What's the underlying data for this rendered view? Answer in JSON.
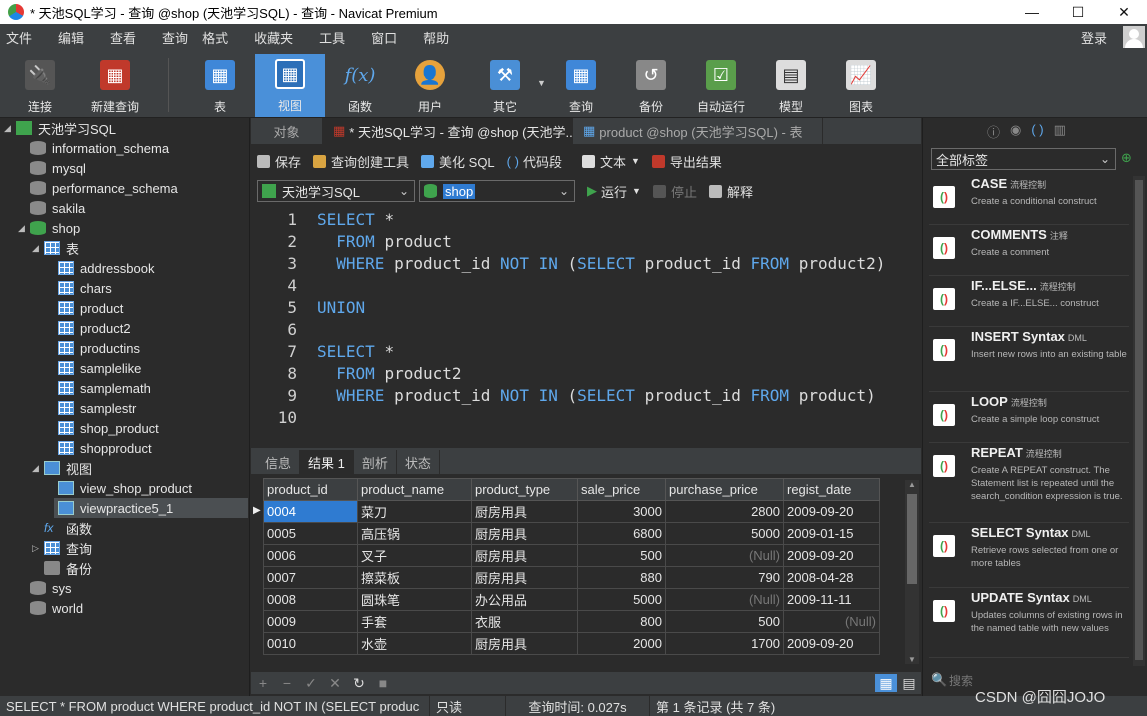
{
  "window": {
    "title": "* 天池SQL学习 - 查询 @shop (天池学习SQL) - 查询 - Navicat Premium"
  },
  "menu": [
    "文件",
    "编辑",
    "查看",
    "查询",
    "格式",
    "收藏夹",
    "工具",
    "窗口",
    "帮助"
  ],
  "login": "登录",
  "toolbar": [
    "连接",
    "新建查询",
    "表",
    "视图",
    "函数",
    "用户",
    "其它",
    "查询",
    "备份",
    "自动运行",
    "模型",
    "图表"
  ],
  "nav": {
    "connection": "天池学习SQL",
    "databases_top": [
      "information_schema",
      "mysql",
      "performance_schema",
      "sakila"
    ],
    "current_db": "shop",
    "tables_label": "表",
    "tables": [
      "addressbook",
      "chars",
      "product",
      "product2",
      "productins",
      "samplelike",
      "samplemath",
      "samplestr",
      "shop_product",
      "shopproduct"
    ],
    "views_label": "视图",
    "views": [
      "view_shop_product",
      "viewpractice5_1"
    ],
    "functions": "函数",
    "queries": "查询",
    "backups": "备份",
    "databases_bottom": [
      "sys",
      "world"
    ]
  },
  "tabs": [
    "对象",
    "* 天池SQL学习 - 查询 @shop (天池学...",
    "product @shop (天池学习SQL) - 表"
  ],
  "editor_toolbar": [
    "保存",
    "查询创建工具",
    "美化 SQL",
    "代码段",
    "文本",
    "导出结果"
  ],
  "selectors": {
    "connection": "天池学习SQL",
    "database": "shop",
    "run": "运行",
    "stop": "停止",
    "explain": "解释"
  },
  "code": [
    {
      "n": "1",
      "t": [
        [
          "kw",
          "SELECT"
        ],
        [
          "",
          "*"
        ]
      ]
    },
    {
      "n": "2",
      "t": [
        [
          "",
          "  "
        ],
        [
          "kw",
          "FROM"
        ],
        [
          "",
          "product"
        ]
      ]
    },
    {
      "n": "3",
      "t": [
        [
          "",
          "  "
        ],
        [
          "kw",
          "WHERE"
        ],
        [
          "",
          "product_id"
        ],
        [
          "kw",
          "NOT IN"
        ],
        [
          "",
          "("
        ],
        [
          "kw",
          "SELECT"
        ],
        [
          "",
          "product_id"
        ],
        [
          "kw",
          "FROM"
        ],
        [
          "",
          "product2)"
        ]
      ]
    },
    {
      "n": "4",
      "t": []
    },
    {
      "n": "5",
      "t": [
        [
          "kw",
          "UNION"
        ]
      ]
    },
    {
      "n": "6",
      "t": []
    },
    {
      "n": "7",
      "t": [
        [
          "kw",
          "SELECT"
        ],
        [
          "",
          "*"
        ]
      ]
    },
    {
      "n": "8",
      "t": [
        [
          "",
          "  "
        ],
        [
          "kw",
          "FROM"
        ],
        [
          "",
          "product2"
        ]
      ]
    },
    {
      "n": "9",
      "t": [
        [
          "",
          "  "
        ],
        [
          "kw",
          "WHERE"
        ],
        [
          "",
          "product_id"
        ],
        [
          "kw",
          "NOT IN"
        ],
        [
          "",
          "("
        ],
        [
          "kw",
          "SELECT"
        ],
        [
          "",
          "product_id"
        ],
        [
          "kw",
          "FROM"
        ],
        [
          "",
          "product)"
        ]
      ]
    },
    {
      "n": "10",
      "t": []
    }
  ],
  "result_tabs": [
    "信息",
    "结果 1",
    "剖析",
    "状态"
  ],
  "grid": {
    "columns": [
      "product_id",
      "product_name",
      "product_type",
      "sale_price",
      "purchase_price",
      "regist_date"
    ],
    "rows": [
      [
        "0004",
        "菜刀",
        "厨房用具",
        "3000",
        "2800",
        "2009-09-20"
      ],
      [
        "0005",
        "高压锅",
        "厨房用具",
        "6800",
        "5000",
        "2009-01-15"
      ],
      [
        "0006",
        "叉子",
        "厨房用具",
        "500",
        "(Null)",
        "2009-09-20"
      ],
      [
        "0007",
        "擦菜板",
        "厨房用具",
        "880",
        "790",
        "2008-04-28"
      ],
      [
        "0008",
        "圆珠笔",
        "办公用品",
        "5000",
        "(Null)",
        "2009-11-11"
      ],
      [
        "0009",
        "手套",
        "衣服",
        "800",
        "500",
        "(Null)"
      ],
      [
        "0010",
        "水壶",
        "厨房用具",
        "2000",
        "1700",
        "2009-09-20"
      ]
    ]
  },
  "status": {
    "sql": "SELECT *   FROM product   WHERE product_id NOT IN (SELECT produc",
    "mode": "只读",
    "time": "查询时间: 0.027s",
    "records": "第 1 条记录 (共 7 条)"
  },
  "right_panel": {
    "filter": "全部标签",
    "search_placeholder": "搜索",
    "snippets": [
      {
        "title": "CASE",
        "tag": "流程控制",
        "desc": "Create a conditional construct"
      },
      {
        "title": "COMMENTS",
        "tag": "注释",
        "desc": "Create a comment"
      },
      {
        "title": "IF...ELSE...",
        "tag": "流程控制",
        "desc": "Create a IF...ELSE... construct"
      },
      {
        "title": "INSERT Syntax",
        "tag": "DML",
        "desc": "Insert new rows into an existing table"
      },
      {
        "title": "LOOP",
        "tag": "流程控制",
        "desc": "Create a simple loop construct"
      },
      {
        "title": "REPEAT",
        "tag": "流程控制",
        "desc": "Create A REPEAT construct. The Statement list is repeated until the search_condition expression is true."
      },
      {
        "title": "SELECT Syntax",
        "tag": "DML",
        "desc": "Retrieve rows selected from one or more tables"
      },
      {
        "title": "UPDATE Syntax",
        "tag": "DML",
        "desc": "Updates columns of existing rows in the named table with new values"
      }
    ]
  },
  "watermark": "CSDN @囧囧JOJO"
}
